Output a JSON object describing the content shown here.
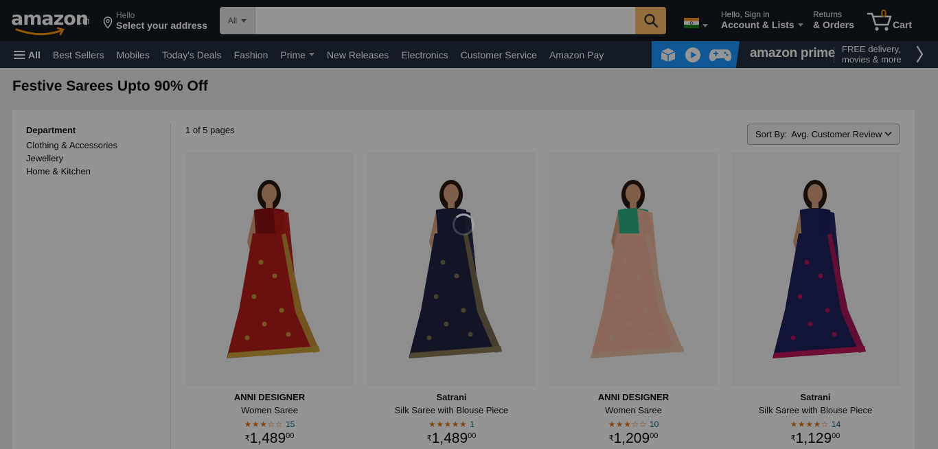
{
  "header": {
    "logo_text": "amazon",
    "logo_suffix": ".in",
    "address_hello": "Hello",
    "address_main": "Select your address",
    "search_category": "All",
    "search_placeholder": "",
    "account_line1": "Hello, Sign in",
    "account_line2": "Account & Lists",
    "returns_line1": "Returns",
    "returns_line2": "& Orders",
    "cart_count": "0",
    "cart_label": "Cart",
    "flag_country": "India"
  },
  "subnav": {
    "all_label": "All",
    "links": [
      "Best Sellers",
      "Mobiles",
      "Today's Deals",
      "Fashion",
      "Prime",
      "New Releases",
      "Electronics",
      "Customer Service",
      "Amazon Pay"
    ],
    "prime_logo": "amazon prime",
    "prime_tag_line1": "FREE delivery,",
    "prime_tag_line2": "movies & more"
  },
  "page": {
    "title": "Festive Sarees Upto 90% Off",
    "page_count": "1 of 5 pages",
    "sort_label": "Sort By:",
    "sort_value": "Avg. Customer Review"
  },
  "department": {
    "title": "Department",
    "items": [
      "Clothing & Accessories",
      "Jewellery",
      "Home & Kitchen"
    ]
  },
  "products": [
    {
      "brand": "ANNI DESIGNER",
      "title": "Women Saree",
      "rating": 2.5,
      "stars": "★★★☆☆",
      "reviews": "15",
      "currency": "₹",
      "price_whole": "1,489",
      "price_fraction": "00",
      "colors": {
        "body": "#b71c1c",
        "border": "#c9a43a",
        "blouse": "#8e1212"
      }
    },
    {
      "brand": "Satrani",
      "title": "Silk Saree with Blouse Piece",
      "rating": 5,
      "stars": "★★★★★",
      "reviews": "1",
      "currency": "₹",
      "price_whole": "1,489",
      "price_fraction": "00",
      "colors": {
        "body": "#1f2444",
        "border": "#8a7a55",
        "blouse": "#1f2444"
      }
    },
    {
      "brand": "ANNI DESIGNER",
      "title": "Women Saree",
      "rating": 3,
      "stars": "★★★☆☆",
      "reviews": "10",
      "currency": "₹",
      "price_whole": "1,209",
      "price_fraction": "00",
      "colors": {
        "body": "#f3b49a",
        "border": "#e8c1a6",
        "blouse": "#2fb38c"
      }
    },
    {
      "brand": "Satrani",
      "title": "Silk Saree with Blouse Piece",
      "rating": 3.5,
      "stars": "★★★★☆",
      "reviews": "14",
      "currency": "₹",
      "price_whole": "1,129",
      "price_fraction": "00",
      "colors": {
        "body": "#1e2160",
        "border": "#c2185b",
        "blouse": "#1e2160"
      }
    }
  ],
  "theme": {
    "nav_bg": "#131921",
    "subnav_bg": "#232f3e",
    "search_button": "#febd69",
    "cart_count_color": "#f08804",
    "prime_blue": "#1a98ff",
    "star_color": "#de7921"
  }
}
